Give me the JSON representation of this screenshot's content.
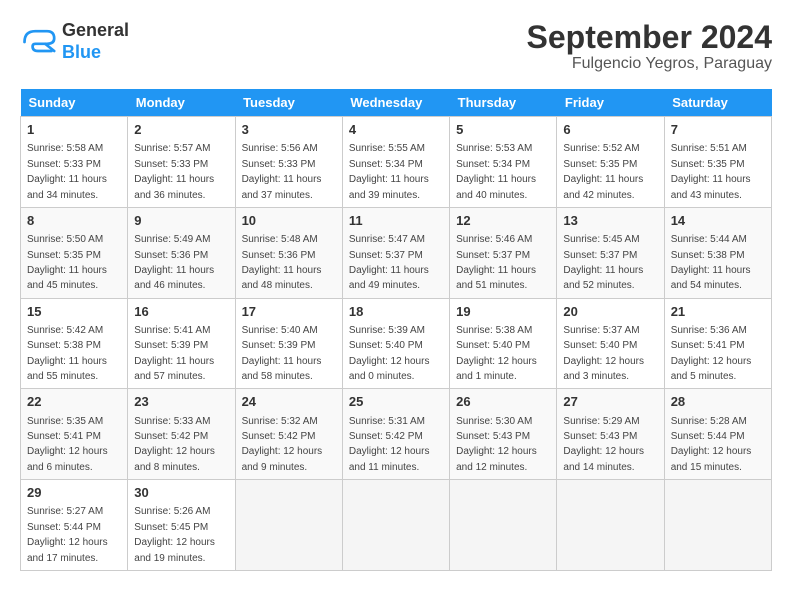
{
  "header": {
    "logo_line1": "General",
    "logo_line2": "Blue",
    "title": "September 2024",
    "subtitle": "Fulgencio Yegros, Paraguay"
  },
  "weekdays": [
    "Sunday",
    "Monday",
    "Tuesday",
    "Wednesday",
    "Thursday",
    "Friday",
    "Saturday"
  ],
  "weeks": [
    [
      {
        "day": "1",
        "sunrise": "5:58 AM",
        "sunset": "5:33 PM",
        "daylight": "11 hours and 34 minutes."
      },
      {
        "day": "2",
        "sunrise": "5:57 AM",
        "sunset": "5:33 PM",
        "daylight": "11 hours and 36 minutes."
      },
      {
        "day": "3",
        "sunrise": "5:56 AM",
        "sunset": "5:33 PM",
        "daylight": "11 hours and 37 minutes."
      },
      {
        "day": "4",
        "sunrise": "5:55 AM",
        "sunset": "5:34 PM",
        "daylight": "11 hours and 39 minutes."
      },
      {
        "day": "5",
        "sunrise": "5:53 AM",
        "sunset": "5:34 PM",
        "daylight": "11 hours and 40 minutes."
      },
      {
        "day": "6",
        "sunrise": "5:52 AM",
        "sunset": "5:35 PM",
        "daylight": "11 hours and 42 minutes."
      },
      {
        "day": "7",
        "sunrise": "5:51 AM",
        "sunset": "5:35 PM",
        "daylight": "11 hours and 43 minutes."
      }
    ],
    [
      {
        "day": "8",
        "sunrise": "5:50 AM",
        "sunset": "5:35 PM",
        "daylight": "11 hours and 45 minutes."
      },
      {
        "day": "9",
        "sunrise": "5:49 AM",
        "sunset": "5:36 PM",
        "daylight": "11 hours and 46 minutes."
      },
      {
        "day": "10",
        "sunrise": "5:48 AM",
        "sunset": "5:36 PM",
        "daylight": "11 hours and 48 minutes."
      },
      {
        "day": "11",
        "sunrise": "5:47 AM",
        "sunset": "5:37 PM",
        "daylight": "11 hours and 49 minutes."
      },
      {
        "day": "12",
        "sunrise": "5:46 AM",
        "sunset": "5:37 PM",
        "daylight": "11 hours and 51 minutes."
      },
      {
        "day": "13",
        "sunrise": "5:45 AM",
        "sunset": "5:37 PM",
        "daylight": "11 hours and 52 minutes."
      },
      {
        "day": "14",
        "sunrise": "5:44 AM",
        "sunset": "5:38 PM",
        "daylight": "11 hours and 54 minutes."
      }
    ],
    [
      {
        "day": "15",
        "sunrise": "5:42 AM",
        "sunset": "5:38 PM",
        "daylight": "11 hours and 55 minutes."
      },
      {
        "day": "16",
        "sunrise": "5:41 AM",
        "sunset": "5:39 PM",
        "daylight": "11 hours and 57 minutes."
      },
      {
        "day": "17",
        "sunrise": "5:40 AM",
        "sunset": "5:39 PM",
        "daylight": "11 hours and 58 minutes."
      },
      {
        "day": "18",
        "sunrise": "5:39 AM",
        "sunset": "5:40 PM",
        "daylight": "12 hours and 0 minutes."
      },
      {
        "day": "19",
        "sunrise": "5:38 AM",
        "sunset": "5:40 PM",
        "daylight": "12 hours and 1 minute."
      },
      {
        "day": "20",
        "sunrise": "5:37 AM",
        "sunset": "5:40 PM",
        "daylight": "12 hours and 3 minutes."
      },
      {
        "day": "21",
        "sunrise": "5:36 AM",
        "sunset": "5:41 PM",
        "daylight": "12 hours and 5 minutes."
      }
    ],
    [
      {
        "day": "22",
        "sunrise": "5:35 AM",
        "sunset": "5:41 PM",
        "daylight": "12 hours and 6 minutes."
      },
      {
        "day": "23",
        "sunrise": "5:33 AM",
        "sunset": "5:42 PM",
        "daylight": "12 hours and 8 minutes."
      },
      {
        "day": "24",
        "sunrise": "5:32 AM",
        "sunset": "5:42 PM",
        "daylight": "12 hours and 9 minutes."
      },
      {
        "day": "25",
        "sunrise": "5:31 AM",
        "sunset": "5:42 PM",
        "daylight": "12 hours and 11 minutes."
      },
      {
        "day": "26",
        "sunrise": "5:30 AM",
        "sunset": "5:43 PM",
        "daylight": "12 hours and 12 minutes."
      },
      {
        "day": "27",
        "sunrise": "5:29 AM",
        "sunset": "5:43 PM",
        "daylight": "12 hours and 14 minutes."
      },
      {
        "day": "28",
        "sunrise": "5:28 AM",
        "sunset": "5:44 PM",
        "daylight": "12 hours and 15 minutes."
      }
    ],
    [
      {
        "day": "29",
        "sunrise": "5:27 AM",
        "sunset": "5:44 PM",
        "daylight": "12 hours and 17 minutes."
      },
      {
        "day": "30",
        "sunrise": "5:26 AM",
        "sunset": "5:45 PM",
        "daylight": "12 hours and 19 minutes."
      },
      null,
      null,
      null,
      null,
      null
    ]
  ]
}
